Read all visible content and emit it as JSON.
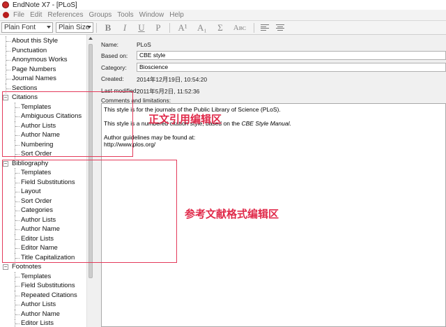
{
  "window": {
    "title": "EndNote X7 - [PLoS]"
  },
  "menubar": [
    "File",
    "Edit",
    "References",
    "Groups",
    "Tools",
    "Window",
    "Help"
  ],
  "toolbar": {
    "font_select": "Plain Font",
    "size_select": "Plain Size",
    "bold": "B",
    "italic": "I",
    "underline": "U",
    "plain": "P",
    "superscript": "A¹",
    "subscript": "A₁",
    "symbol": "Σ",
    "case": "Aʙᴄ"
  },
  "tree": {
    "top_items": [
      "About this Style",
      "Punctuation",
      "Anonymous Works",
      "Page Numbers",
      "Journal Names",
      "Sections"
    ],
    "citations": {
      "label": "Citations",
      "children": [
        "Templates",
        "Ambiguous Citations",
        "Author Lists",
        "Author Name",
        "Numbering",
        "Sort Order"
      ]
    },
    "bibliography": {
      "label": "Bibliography",
      "children": [
        "Templates",
        "Field Substitutions",
        "Layout",
        "Sort Order",
        "Categories",
        "Author Lists",
        "Author Name",
        "Editor Lists",
        "Editor Name",
        "Title Capitalization"
      ]
    },
    "footnotes": {
      "label": "Footnotes",
      "children": [
        "Templates",
        "Field Substitutions",
        "Repeated Citations",
        "Author Lists",
        "Author Name",
        "Editor Lists"
      ]
    }
  },
  "details": {
    "name_label": "Name:",
    "name_value": "PLoS",
    "based_on_label": "Based on:",
    "based_on_value": "CBE style",
    "category_label": "Category:",
    "category_value": "Bioscience",
    "created_label": "Created:",
    "created_value": "2014年12月19日, 10:54:20",
    "modified_label": "Last modified:",
    "modified_value": "2011年5月2日, 11:52:36",
    "comments_label": "Comments and limitations:",
    "comments": {
      "line1": "This style is for the journals of the Public Library of Science (PLoS).",
      "line2_pre": "This style is a numbered citation style, based on the ",
      "line2_em": "CBE Style Manual",
      "line2_post": ".",
      "line3": "Author guidelines may be found at:",
      "line4": "http://www.plos.org/"
    }
  },
  "annotations": {
    "citation_label": "正文引用编辑区",
    "bibliography_label": "参考文献格式编辑区",
    "color": "#e02a4a"
  },
  "colors": {
    "accent": "#e33a5a"
  }
}
